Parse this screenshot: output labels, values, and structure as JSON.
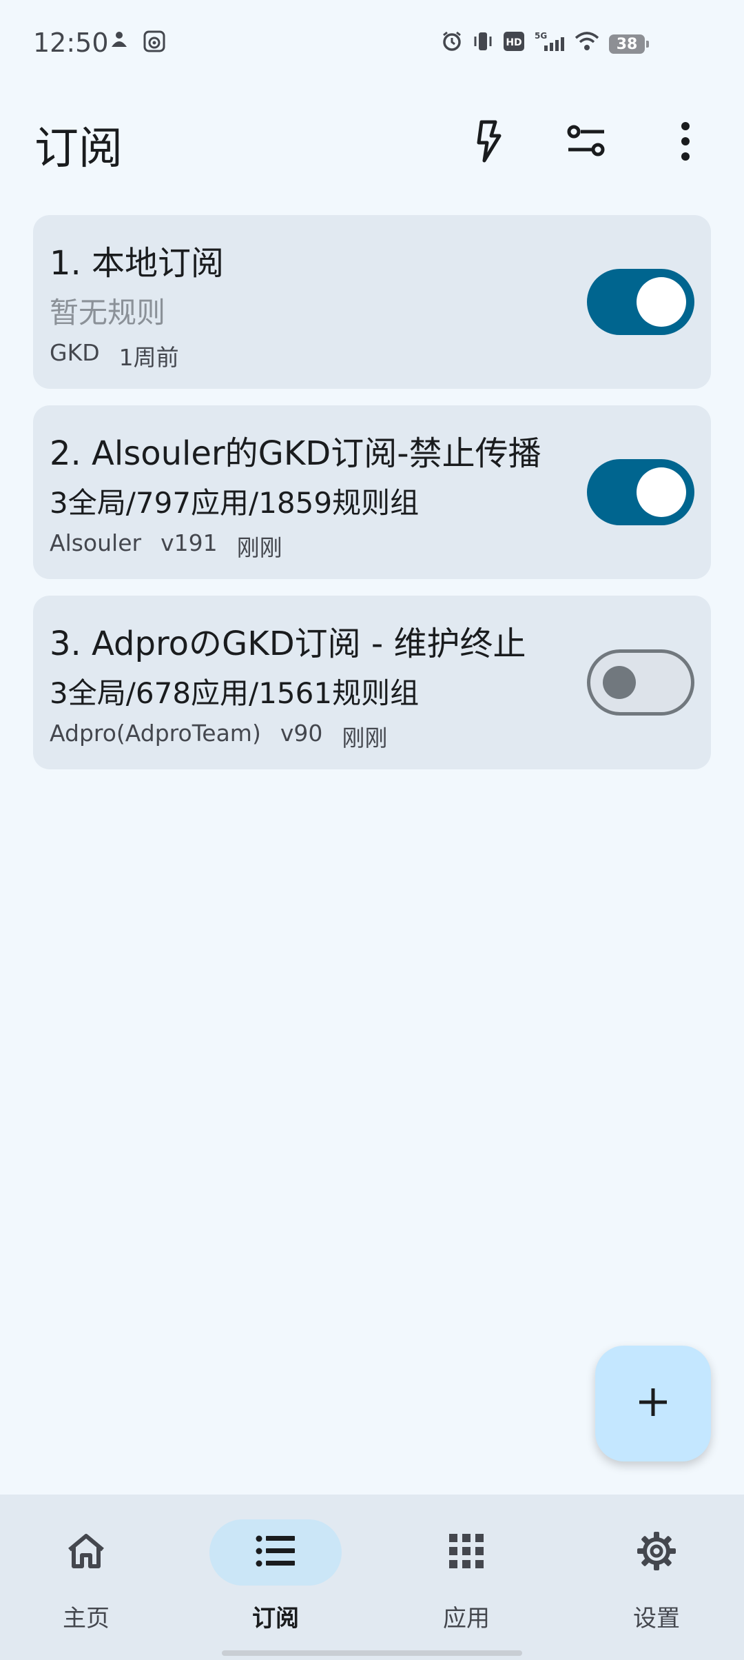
{
  "status_bar": {
    "time": "12:50",
    "battery": "38",
    "left_icons": [
      "profile-icon",
      "app-notification-icon"
    ],
    "right_icons": [
      "alarm-icon",
      "vibrate-icon",
      "hd-icon",
      "5g-signal-icon",
      "wifi-icon",
      "battery-icon"
    ]
  },
  "app_bar": {
    "title": "订阅",
    "actions": [
      "bolt-icon",
      "filter-icon",
      "more-vert-icon"
    ]
  },
  "subscriptions": [
    {
      "title": "1. 本地订阅",
      "summary": "暂无规则",
      "summary_muted": true,
      "meta": [
        "GKD",
        "1周前"
      ],
      "enabled": true
    },
    {
      "title": "2. Alsouler的GKD订阅-禁止传播",
      "summary": "3全局/797应用/1859规则组",
      "summary_muted": false,
      "meta": [
        "Alsouler",
        "v191",
        "刚刚"
      ],
      "enabled": true
    },
    {
      "title": "3. AdproのGKD订阅 - 维护终止",
      "summary": "3全局/678应用/1561规则组",
      "summary_muted": false,
      "meta": [
        "Adpro(AdproTeam)",
        "v90",
        "刚刚"
      ],
      "enabled": false
    }
  ],
  "fab": {
    "icon": "plus-icon"
  },
  "bottom_nav": {
    "items": [
      {
        "label": "主页",
        "icon": "home-icon",
        "active": false
      },
      {
        "label": "订阅",
        "icon": "list-icon",
        "active": true
      },
      {
        "label": "应用",
        "icon": "grid-icon",
        "active": false
      },
      {
        "label": "设置",
        "icon": "gear-icon",
        "active": false
      }
    ]
  },
  "colors": {
    "background": "#f2f8fd",
    "card": "#e1e9f1",
    "switch_on": "#00658f",
    "switch_off_track": "#dde3ea",
    "switch_off_outline": "#71787e",
    "fab": "#c4e7ff",
    "nav_indicator": "#cbe6f7"
  }
}
